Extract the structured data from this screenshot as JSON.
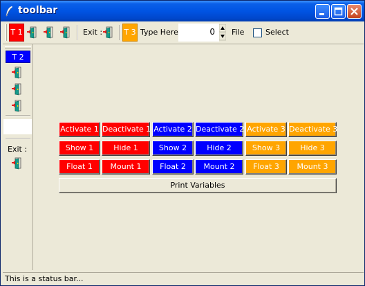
{
  "window": {
    "title": "toolbar"
  },
  "toolbar": {
    "t1_label": "T 1",
    "exit_label": "Exit :",
    "t3_label": "T 3",
    "type_here_label": "Type Here:",
    "spin_value": "0",
    "file_label": "File",
    "select_label": "Select",
    "select_checked": false
  },
  "sidebar": {
    "t2_label": "T 2",
    "entry_value": "",
    "exit_label": "Exit :"
  },
  "grid": {
    "row1": [
      "Activate 1",
      "Deactivate 1",
      "Activate 2",
      "Deactivate 2",
      "Activate 3",
      "Deactivate 3"
    ],
    "row2": [
      "Show 1",
      "Hide 1",
      "Show 2",
      "Hide 2",
      "Show 3",
      "Hide 3"
    ],
    "row3": [
      "Float 1",
      "Mount 1",
      "Float 2",
      "Mount 2",
      "Float 3",
      "Mount 3"
    ]
  },
  "print_button": "Print Variables",
  "status_bar": "This is a status bar...",
  "colors": {
    "group1": "#ff0000",
    "group2": "#0000ff",
    "group3": "#ffa500",
    "titlebar": "#0054e3",
    "face": "#ece9d8"
  },
  "icons": [
    "feather-icon",
    "door-exit-icon",
    "minimize-icon",
    "maximize-icon",
    "close-icon",
    "spin-up-icon",
    "spin-down-icon"
  ]
}
